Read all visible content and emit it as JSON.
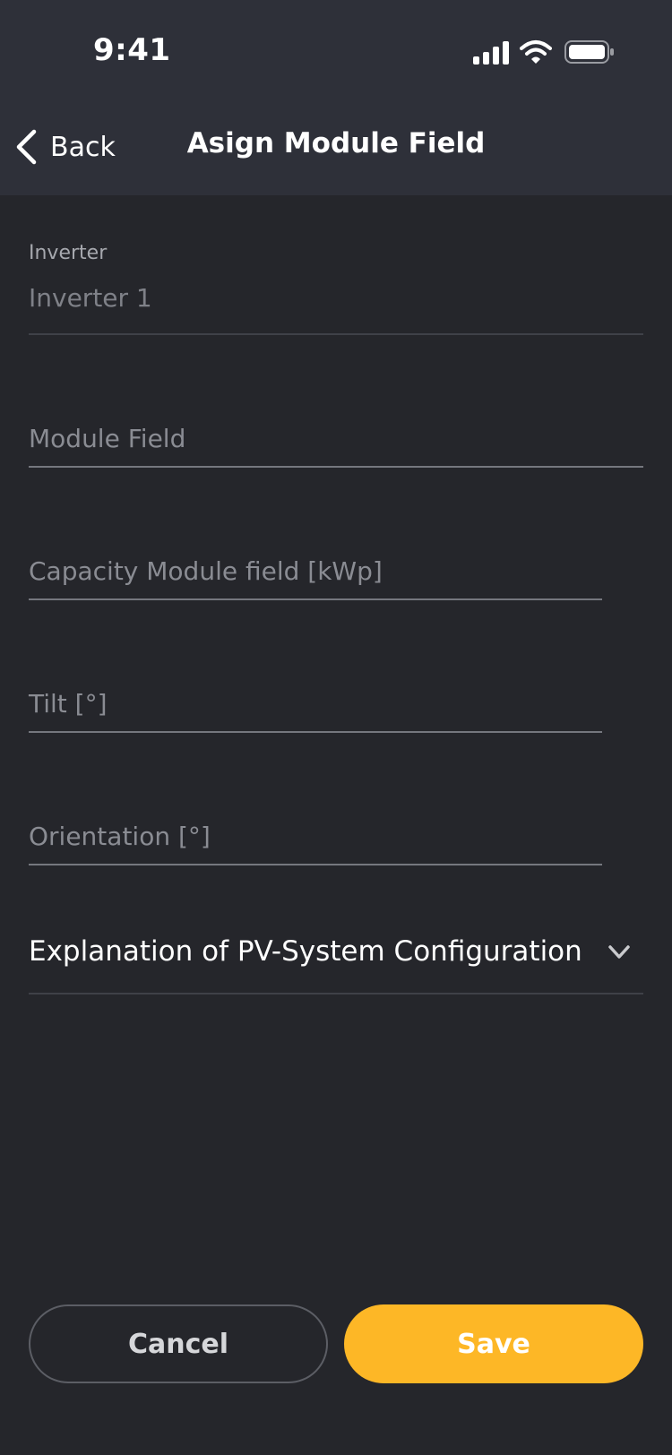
{
  "status_bar": {
    "time": "9:41",
    "icons": [
      "cellular-signal-icon",
      "wifi-icon",
      "battery-icon"
    ]
  },
  "nav": {
    "back_label": "Back",
    "title": "Asign Module Field"
  },
  "form": {
    "inverter": {
      "label": "Inverter",
      "value": "Inverter 1"
    },
    "module_field": {
      "placeholder": "Module Field"
    },
    "capacity": {
      "placeholder": "Capacity Module field [kWp]"
    },
    "tilt": {
      "placeholder": "Tilt [°]"
    },
    "orientation": {
      "placeholder": "Orientation [°]"
    },
    "explanation": {
      "label": "Explanation of PV-System Configuration",
      "icon": "chevron-down-icon"
    }
  },
  "actions": {
    "cancel_label": "Cancel",
    "save_label": "Save"
  },
  "colors": {
    "background": "#25262b",
    "header": "#2e3039",
    "accent": "#fdb726"
  }
}
